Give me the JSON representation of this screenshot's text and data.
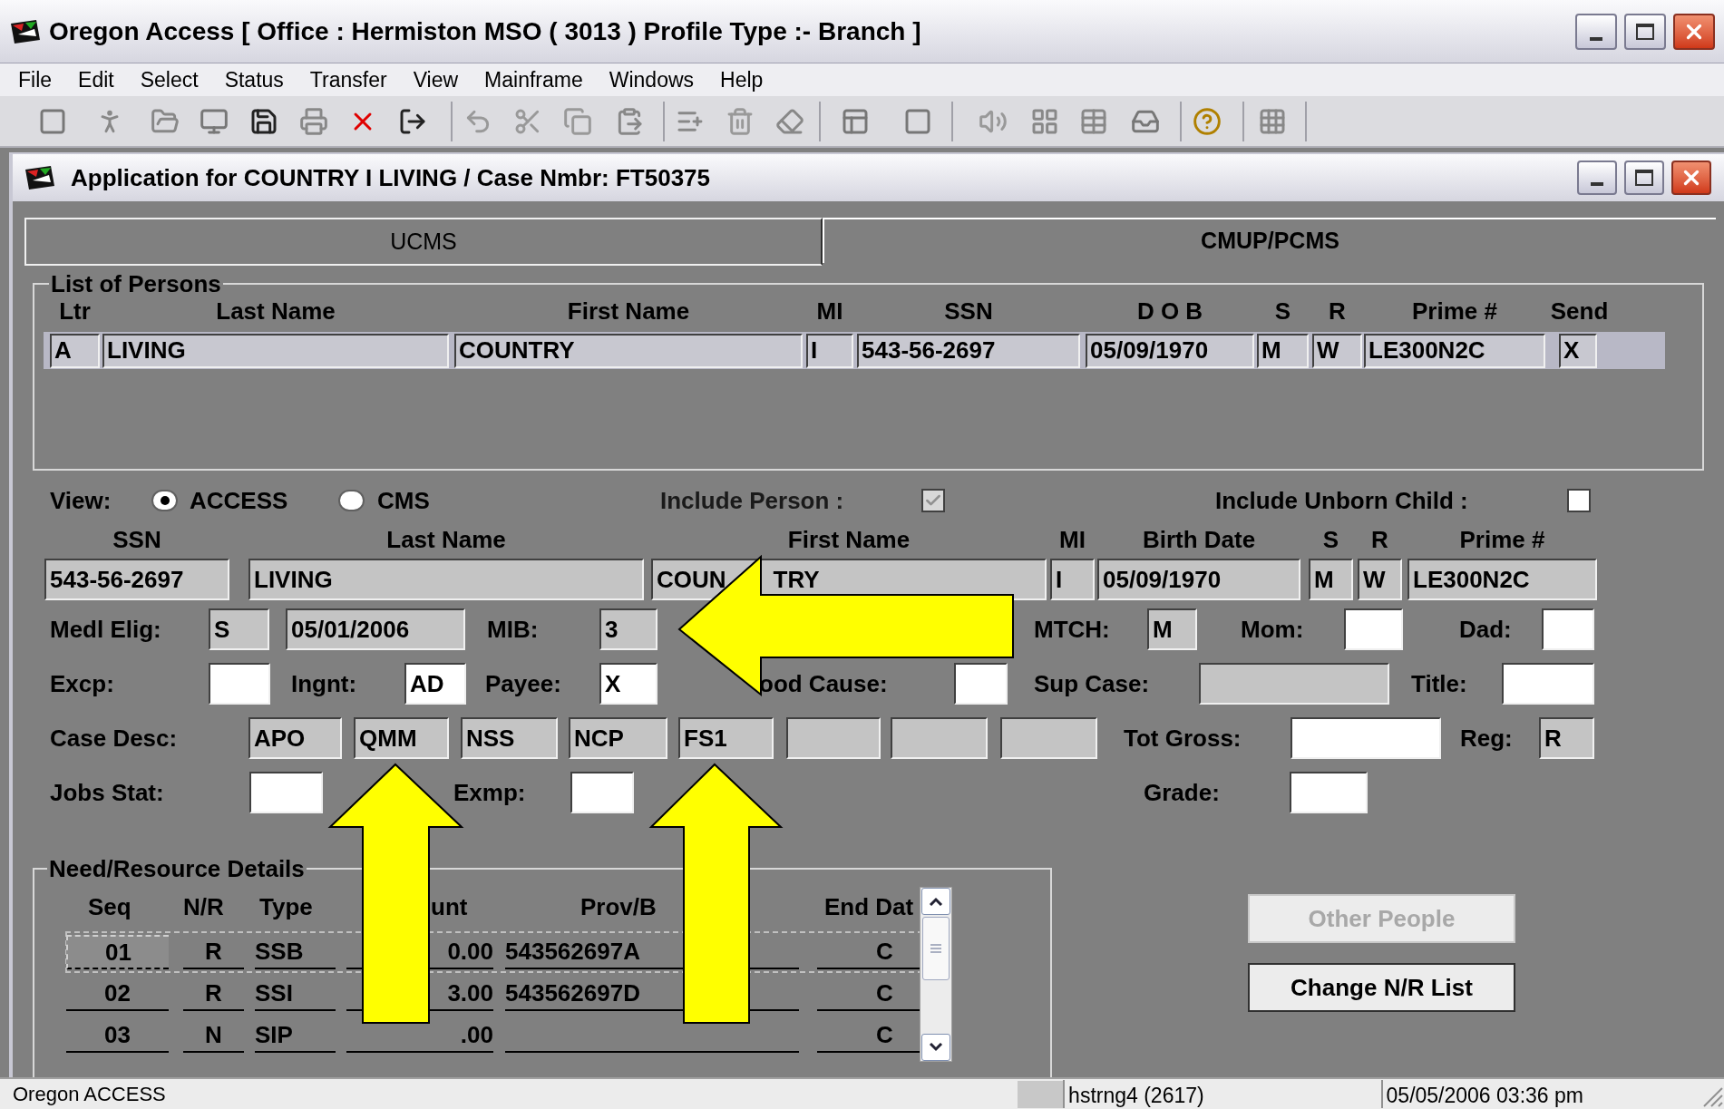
{
  "window": {
    "title": "Oregon Access [ Office : Hermiston MSO ( 3013 ) Profile Type :- Branch ]"
  },
  "menu": [
    "File",
    "Edit",
    "Select",
    "Status",
    "Transfer",
    "View",
    "Mainframe",
    "Windows",
    "Help"
  ],
  "child_window": {
    "title": "Application for COUNTRY I LIVING / Case Nmbr: FT50375"
  },
  "tabs": [
    {
      "label": "UCMS",
      "selected": false
    },
    {
      "label": "CMUP/PCMS",
      "selected": true
    }
  ],
  "persons": {
    "title": "List of Persons",
    "columns": [
      "Ltr",
      "Last Name",
      "First Name",
      "MI",
      "SSN",
      "D O B",
      "S",
      "R",
      "Prime #",
      "Send"
    ],
    "rows": [
      {
        "selected": true,
        "cells": [
          "A",
          "LIVING",
          "COUNTRY",
          "I",
          "543-56-2697",
          "05/09/1970",
          "M",
          "W",
          "LE300N2C",
          "X"
        ]
      }
    ]
  },
  "view": {
    "label": "View:",
    "options": [
      {
        "label": "ACCESS",
        "selected": true
      },
      {
        "label": "CMS",
        "selected": false
      }
    ]
  },
  "include_person": {
    "label": "Include Person :",
    "checked": true,
    "disabled": true
  },
  "include_unborn_child": {
    "label": "Include Unborn Child :",
    "checked": false,
    "disabled": false
  },
  "person": {
    "columns": [
      "SSN",
      "Last Name",
      "First Name",
      "MI",
      "Birth Date",
      "S",
      "R",
      "Prime #"
    ],
    "fields": [
      {
        "value": "543-56-2697",
        "editable": false
      },
      {
        "value": "LIVING",
        "editable": false
      },
      {
        "parts": [
          "COUN",
          "TRY"
        ],
        "editable": false
      },
      {
        "value": "I",
        "editable": false
      },
      {
        "value": "05/09/1970",
        "editable": false
      },
      {
        "value": "M",
        "editable": false
      },
      {
        "value": "W",
        "editable": false
      },
      {
        "value": "LE300N2C",
        "editable": false
      }
    ]
  },
  "form_rows": [
    {
      "items": [
        {
          "kind": "label",
          "text": "Medl Elig:"
        },
        {
          "kind": "field",
          "value": "S",
          "editable": false
        },
        {
          "kind": "field",
          "value": "05/01/2006",
          "editable": false
        },
        {
          "kind": "label",
          "text": "MIB:"
        },
        {
          "kind": "field",
          "value": "3",
          "editable": false
        },
        {
          "kind": "label",
          "text": "MTCH:"
        },
        {
          "kind": "field",
          "value": "M",
          "editable": false
        },
        {
          "kind": "label",
          "text": "Mom:"
        },
        {
          "kind": "field",
          "editable": true
        },
        {
          "kind": "label",
          "text": "Dad:"
        },
        {
          "kind": "field",
          "editable": true
        }
      ]
    },
    {
      "items": [
        {
          "kind": "label",
          "text": "Excp:"
        },
        {
          "kind": "field",
          "editable": true
        },
        {
          "kind": "label",
          "text": "Ingnt:"
        },
        {
          "kind": "field",
          "value": "AD",
          "editable": true
        },
        {
          "kind": "label",
          "text": "Payee:"
        },
        {
          "kind": "field",
          "value": "X",
          "editable": true
        },
        {
          "kind": "label",
          "text": "ood Cause:"
        },
        {
          "kind": "field",
          "editable": true
        },
        {
          "kind": "label",
          "text": "Sup Case:"
        },
        {
          "kind": "field",
          "editable": false
        },
        {
          "kind": "label",
          "text": "Title:"
        },
        {
          "kind": "field",
          "editable": true
        }
      ]
    },
    {
      "items": [
        {
          "kind": "label",
          "text": "Case Desc:"
        },
        {
          "kind": "field",
          "value": "APO",
          "editable": false
        },
        {
          "kind": "field",
          "value": "QMM",
          "editable": false
        },
        {
          "kind": "field",
          "value": "NSS",
          "editable": false
        },
        {
          "kind": "field",
          "value": "NCP",
          "editable": false
        },
        {
          "kind": "field",
          "value": "FS1",
          "editable": false
        },
        {
          "kind": "field",
          "editable": false
        },
        {
          "kind": "field",
          "editable": false
        },
        {
          "kind": "field",
          "editable": false
        },
        {
          "kind": "label",
          "text": "Tot Gross:"
        },
        {
          "kind": "field",
          "editable": true
        },
        {
          "kind": "label",
          "text": "Reg:"
        },
        {
          "kind": "field",
          "value": "R",
          "editable": false
        }
      ]
    },
    {
      "items": [
        {
          "kind": "label",
          "text": "Jobs Stat:"
        },
        {
          "kind": "field",
          "editable": true
        },
        {
          "kind": "label",
          "text": "Exmp:"
        },
        {
          "kind": "field",
          "editable": true
        },
        {
          "kind": "label",
          "text": "Grade:"
        },
        {
          "kind": "field",
          "editable": true
        }
      ]
    }
  ],
  "need_resource": {
    "title": "Need/Resource Details",
    "columns": [
      "Seq",
      "N/R",
      "Type",
      "unt",
      "Prov/B",
      "End Dat"
    ],
    "rows": [
      {
        "focused": true,
        "cells": [
          "01",
          "R",
          "SSB",
          "0.00",
          "543562697A",
          "C"
        ]
      },
      {
        "focused": false,
        "cells": [
          "02",
          "R",
          "SSI",
          "3.00",
          "543562697D",
          "C"
        ]
      },
      {
        "focused": false,
        "cells": [
          "03",
          "N",
          "SIP",
          ".00",
          "",
          "C"
        ]
      }
    ]
  },
  "buttons": [
    {
      "label": "Other People",
      "disabled": true
    },
    {
      "label": "Change N/R List",
      "disabled": false
    }
  ],
  "status_bar": [
    "Oregon ACCESS",
    "hstrng4 (2617)",
    "05/05/2006 03:36 pm"
  ]
}
